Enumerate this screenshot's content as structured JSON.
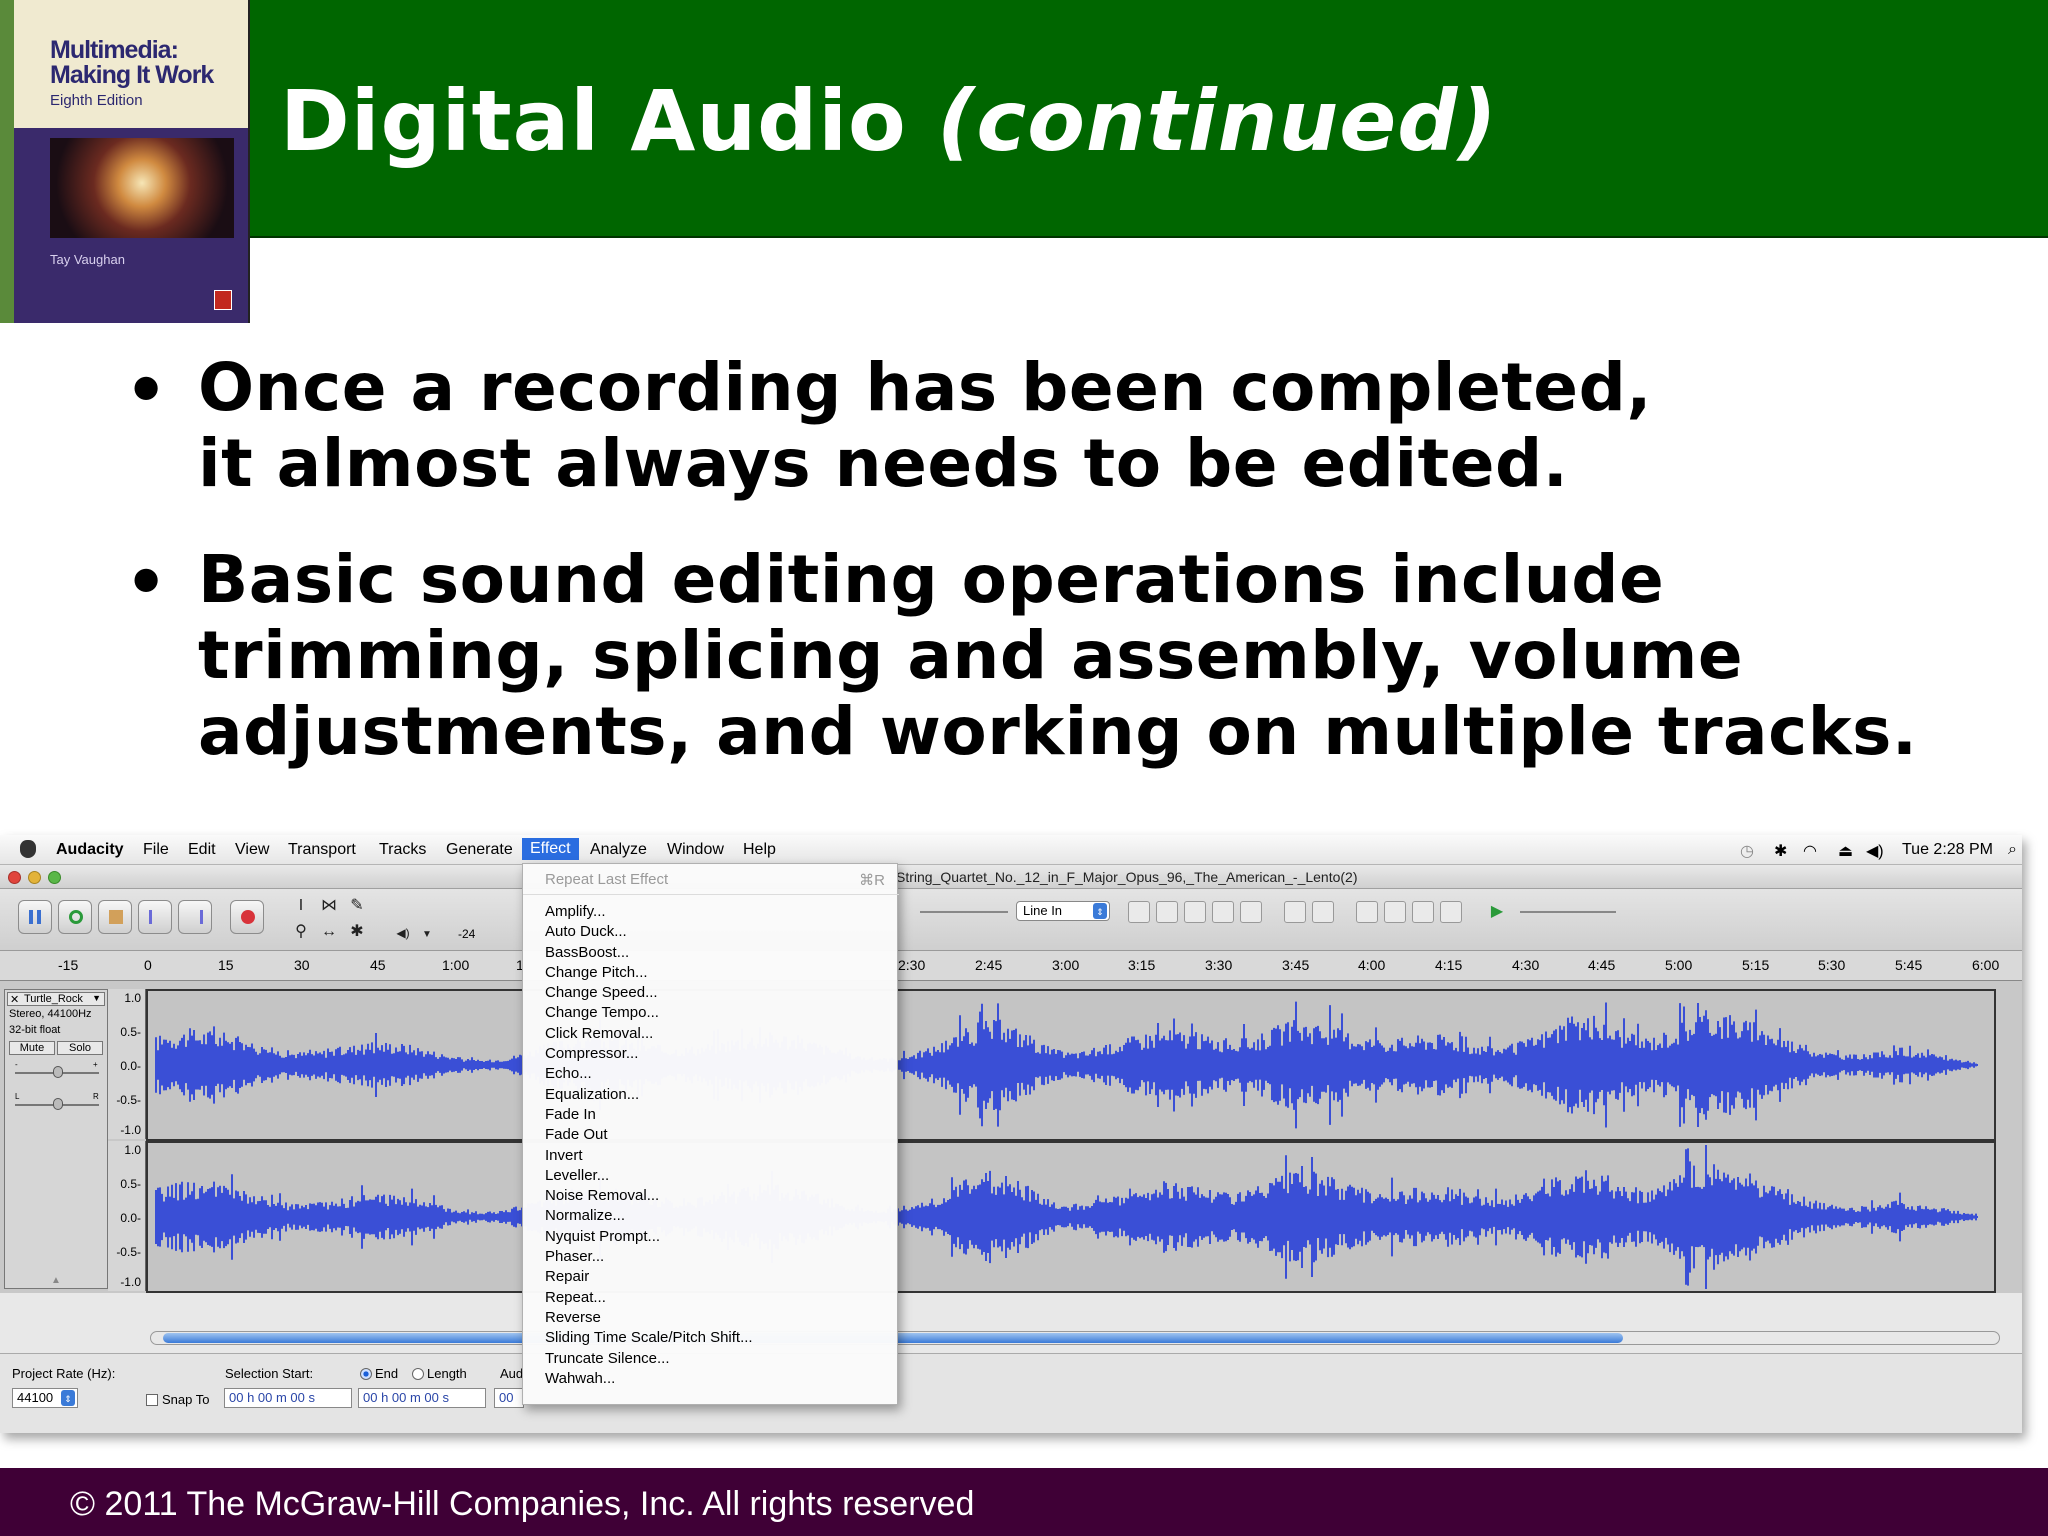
{
  "slide": {
    "title_main": "Digital Audio",
    "title_italic": "(continued)",
    "bullets": [
      {
        "line1": "Once a recording has been completed,",
        "line2": "it almost always needs to be edited."
      },
      {
        "line1": "Basic sound editing operations include",
        "line2": "trimming, splicing and assembly, volume",
        "line3": "adjustments, and working on multiple tracks."
      }
    ],
    "footer": "© 2011 The McGraw-Hill Companies, Inc. All rights reserved"
  },
  "cover": {
    "title": "Multimedia: Making It Work",
    "edition": "Eighth Edition",
    "author": "Tay Vaughan"
  },
  "menubar": {
    "app_name": "Audacity",
    "items": [
      "File",
      "Edit",
      "View",
      "Transport",
      "Tracks",
      "Generate",
      "Effect",
      "Analyze",
      "Window",
      "Help"
    ],
    "active": "Effect",
    "clock": "Tue 2:28 PM"
  },
  "window": {
    "title": "String_Quartet_No._12_in_F_Major_Opus_96,_The_American_-_Lento(2)",
    "input_source": "Line In",
    "meter_label": "-24"
  },
  "ruler": {
    "ticks": [
      "-15",
      "0",
      "15",
      "30",
      "45",
      "1:00",
      "1",
      "2:30",
      "2:45",
      "3:00",
      "3:15",
      "3:30",
      "3:45",
      "4:00",
      "4:15",
      "4:30",
      "4:45",
      "5:00",
      "5:15",
      "5:30",
      "5:45",
      "6:00"
    ]
  },
  "track": {
    "name": "Turtle_Rock",
    "format": "Stereo, 44100Hz",
    "bits": "32-bit float",
    "mute": "Mute",
    "solo": "Solo",
    "gain_minus": "-",
    "gain_plus": "+",
    "pan_l": "L",
    "pan_r": "R",
    "scale": [
      "1.0",
      "0.5-",
      "0.0-",
      "-0.5-",
      "-1.0"
    ]
  },
  "selection": {
    "project_rate_label": "Project Rate (Hz):",
    "project_rate": "44100",
    "snap_to": "Snap To",
    "selection_start_label": "Selection Start:",
    "end_label": "End",
    "length_label": "Length",
    "audio_pos_label": "Aud",
    "start_value": "00 h 00 m 00 s",
    "end_value": "00 h 00 m 00 s",
    "extra_value": "00"
  },
  "effect_menu": {
    "repeat_last": "Repeat Last Effect",
    "repeat_shortcut": "⌘R",
    "items": [
      "Amplify...",
      "Auto Duck...",
      "BassBoost...",
      "Change Pitch...",
      "Change Speed...",
      "Change Tempo...",
      "Click Removal...",
      "Compressor...",
      "Echo...",
      "Equalization...",
      "Fade In",
      "Fade Out",
      "Invert",
      "Leveller...",
      "Noise Removal...",
      "Normalize...",
      "Nyquist Prompt...",
      "Phaser...",
      "Repair",
      "Repeat...",
      "Reverse",
      "Sliding Time Scale/Pitch Shift...",
      "Truncate Silence...",
      "Wahwah..."
    ]
  },
  "colors": {
    "header_green": "#006600",
    "footer_purple": "#3f0036",
    "waveform_blue": "#3a4fd6",
    "menu_highlight": "#2a6de0"
  }
}
